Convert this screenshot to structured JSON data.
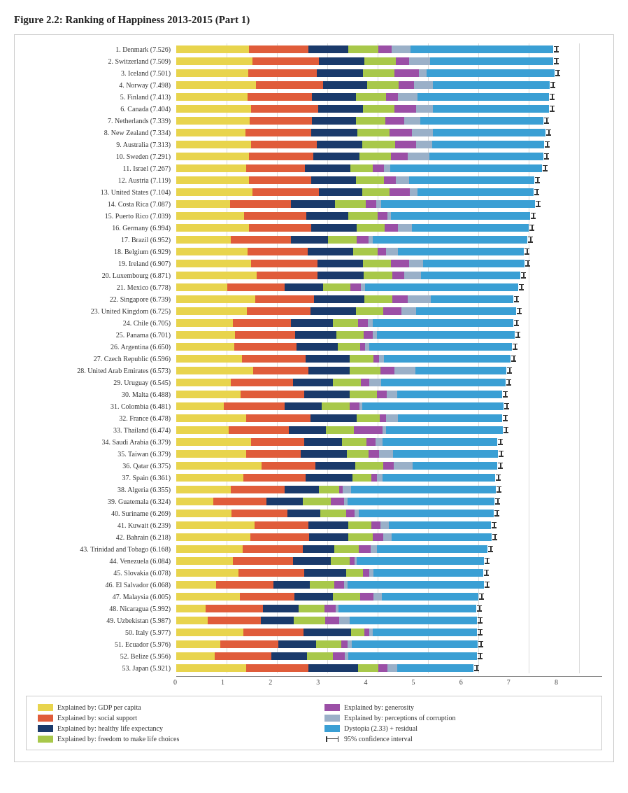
{
  "title": "Figure 2.2: Ranking of Happiness 2013-2015 (Part 1)",
  "colors": {
    "gdp": "#e8d44d",
    "social": "#e05c3a",
    "health": "#1a3a6b",
    "freedom": "#a8c84a",
    "generosity": "#9b4fa6",
    "corruption": "#9ab0c8",
    "dystopia": "#3a9fd4"
  },
  "scale": {
    "min": 0,
    "max": 8,
    "ticks": [
      0,
      1,
      2,
      3,
      4,
      5,
      6,
      7,
      8
    ],
    "pixelsPerUnit": 72
  },
  "countries": [
    {
      "rank": 1,
      "name": "Denmark (7.526)",
      "gdp": 1.44,
      "social": 1.18,
      "health": 0.79,
      "freedom": 0.6,
      "generosity": 0.26,
      "corruption": 0.38,
      "dystopia": 2.84
    },
    {
      "rank": 2,
      "name": "Switzerland (7.509)",
      "gdp": 1.52,
      "social": 1.32,
      "health": 0.9,
      "freedom": 0.62,
      "generosity": 0.26,
      "corruption": 0.41,
      "dystopia": 2.45
    },
    {
      "rank": 3,
      "name": "Iceland (7.501)",
      "gdp": 1.43,
      "social": 1.36,
      "health": 0.91,
      "freedom": 0.63,
      "generosity": 0.48,
      "corruption": 0.15,
      "dystopia": 2.54
    },
    {
      "rank": 4,
      "name": "Norway (7.498)",
      "gdp": 1.58,
      "social": 1.33,
      "health": 0.88,
      "freedom": 0.63,
      "generosity": 0.3,
      "corruption": 0.37,
      "dystopia": 2.32
    },
    {
      "rank": 5,
      "name": "Finland (7.413)",
      "gdp": 1.41,
      "social": 1.28,
      "health": 0.88,
      "freedom": 0.6,
      "generosity": 0.23,
      "corruption": 0.39,
      "dystopia": 2.61
    },
    {
      "rank": 6,
      "name": "Canada (7.404)",
      "gdp": 1.48,
      "social": 1.33,
      "health": 0.89,
      "freedom": 0.63,
      "generosity": 0.43,
      "corruption": 0.33,
      "dystopia": 2.3
    },
    {
      "rank": 7,
      "name": "Netherlands (7.339)",
      "gdp": 1.46,
      "social": 1.23,
      "health": 0.88,
      "freedom": 0.58,
      "generosity": 0.38,
      "corruption": 0.32,
      "dystopia": 2.45
    },
    {
      "rank": 8,
      "name": "New Zealand (7.334)",
      "gdp": 1.37,
      "social": 1.31,
      "health": 0.91,
      "freedom": 0.64,
      "generosity": 0.44,
      "corruption": 0.41,
      "dystopia": 2.24
    },
    {
      "rank": 9,
      "name": "Australia (7.313)",
      "gdp": 1.48,
      "social": 1.31,
      "health": 0.9,
      "freedom": 0.65,
      "generosity": 0.41,
      "corruption": 0.32,
      "dystopia": 2.22
    },
    {
      "rank": 10,
      "name": "Sweden (7.291)",
      "gdp": 1.45,
      "social": 1.28,
      "health": 0.91,
      "freedom": 0.62,
      "generosity": 0.34,
      "corruption": 0.43,
      "dystopia": 2.26
    },
    {
      "rank": 11,
      "name": "Israel (7.267)",
      "gdp": 1.39,
      "social": 1.17,
      "health": 0.9,
      "freedom": 0.45,
      "generosity": 0.22,
      "corruption": 0.12,
      "dystopia": 3.02
    },
    {
      "rank": 12,
      "name": "Austria (7.119)",
      "gdp": 1.45,
      "social": 1.23,
      "health": 0.89,
      "freedom": 0.55,
      "generosity": 0.24,
      "corruption": 0.27,
      "dystopia": 2.49
    },
    {
      "rank": 13,
      "name": "United States (7.104)",
      "gdp": 1.51,
      "social": 1.32,
      "health": 0.86,
      "freedom": 0.54,
      "generosity": 0.4,
      "corruption": 0.15,
      "dystopia": 2.31
    },
    {
      "rank": 14,
      "name": "Costa Rica (7.087)",
      "gdp": 1.07,
      "social": 1.21,
      "health": 0.88,
      "freedom": 0.61,
      "generosity": 0.21,
      "corruption": 0.1,
      "dystopia": 3.05
    },
    {
      "rank": 15,
      "name": "Puerto Rico (7.039)",
      "gdp": 1.35,
      "social": 1.23,
      "health": 0.83,
      "freedom": 0.59,
      "generosity": 0.19,
      "corruption": 0.07,
      "dystopia": 2.76
    },
    {
      "rank": 16,
      "name": "Germany (6.994)",
      "gdp": 1.44,
      "social": 1.24,
      "health": 0.9,
      "freedom": 0.55,
      "generosity": 0.27,
      "corruption": 0.28,
      "dystopia": 2.32
    },
    {
      "rank": 17,
      "name": "Brazil (6.952)",
      "gdp": 1.08,
      "social": 1.19,
      "health": 0.74,
      "freedom": 0.57,
      "generosity": 0.24,
      "corruption": 0.08,
      "dystopia": 3.07
    },
    {
      "rank": 18,
      "name": "Belgium (6.929)",
      "gdp": 1.42,
      "social": 1.2,
      "health": 0.9,
      "freedom": 0.49,
      "generosity": 0.17,
      "corruption": 0.23,
      "dystopia": 2.5
    },
    {
      "rank": 19,
      "name": "Ireland (6.907)",
      "gdp": 1.48,
      "social": 1.32,
      "health": 0.9,
      "freedom": 0.55,
      "generosity": 0.36,
      "corruption": 0.28,
      "dystopia": 2.02
    },
    {
      "rank": 20,
      "name": "Luxembourg (6.871)",
      "gdp": 1.6,
      "social": 1.21,
      "health": 0.91,
      "freedom": 0.57,
      "generosity": 0.23,
      "corruption": 0.34,
      "dystopia": 1.97
    },
    {
      "rank": 21,
      "name": "Mexico (6.778)",
      "gdp": 1.02,
      "social": 1.14,
      "health": 0.76,
      "freedom": 0.54,
      "generosity": 0.21,
      "corruption": 0.08,
      "dystopia": 3.04
    },
    {
      "rank": 22,
      "name": "Singapore (6.739)",
      "gdp": 1.57,
      "social": 1.16,
      "health": 1.0,
      "freedom": 0.56,
      "generosity": 0.31,
      "corruption": 0.46,
      "dystopia": 1.64
    },
    {
      "rank": 23,
      "name": "United Kingdom (6.725)",
      "gdp": 1.4,
      "social": 1.26,
      "health": 0.9,
      "freedom": 0.54,
      "generosity": 0.36,
      "corruption": 0.29,
      "dystopia": 1.98
    },
    {
      "rank": 24,
      "name": "Chile (6.705)",
      "gdp": 1.13,
      "social": 1.15,
      "health": 0.84,
      "freedom": 0.5,
      "generosity": 0.19,
      "corruption": 0.1,
      "dystopia": 2.79
    },
    {
      "rank": 25,
      "name": "Panama (6.701)",
      "gdp": 1.17,
      "social": 1.2,
      "health": 0.82,
      "freedom": 0.54,
      "generosity": 0.18,
      "corruption": 0.09,
      "dystopia": 2.73
    },
    {
      "rank": 26,
      "name": "Argentina (6.650)",
      "gdp": 1.15,
      "social": 1.23,
      "health": 0.82,
      "freedom": 0.44,
      "generosity": 0.1,
      "corruption": 0.08,
      "dystopia": 2.83
    },
    {
      "rank": 27,
      "name": "Czech Republic (6.596)",
      "gdp": 1.3,
      "social": 1.27,
      "health": 0.87,
      "freedom": 0.47,
      "generosity": 0.11,
      "corruption": 0.1,
      "dystopia": 2.51
    },
    {
      "rank": 28,
      "name": "United Arab Emirates (6.573)",
      "gdp": 1.53,
      "social": 1.1,
      "health": 0.82,
      "freedom": 0.61,
      "generosity": 0.28,
      "corruption": 0.41,
      "dystopia": 1.81
    },
    {
      "rank": 29,
      "name": "Uruguay (6.545)",
      "gdp": 1.09,
      "social": 1.23,
      "health": 0.79,
      "freedom": 0.56,
      "generosity": 0.16,
      "corruption": 0.24,
      "dystopia": 2.47
    },
    {
      "rank": 30,
      "name": "Malta (6.488)",
      "gdp": 1.28,
      "social": 1.27,
      "health": 0.9,
      "freedom": 0.54,
      "generosity": 0.19,
      "corruption": 0.21,
      "dystopia": 2.09
    },
    {
      "rank": 31,
      "name": "Colombia (6.481)",
      "gdp": 0.94,
      "social": 1.21,
      "health": 0.74,
      "freedom": 0.55,
      "generosity": 0.19,
      "corruption": 0.05,
      "dystopia": 2.81
    },
    {
      "rank": 32,
      "name": "France (6.478)",
      "gdp": 1.39,
      "social": 1.28,
      "health": 0.92,
      "freedom": 0.46,
      "generosity": 0.12,
      "corruption": 0.23,
      "dystopia": 2.07
    },
    {
      "rank": 33,
      "name": "Thailand (6.474)",
      "gdp": 1.04,
      "social": 1.2,
      "health": 0.73,
      "freedom": 0.55,
      "generosity": 0.57,
      "corruption": 0.07,
      "dystopia": 2.32
    },
    {
      "rank": 34,
      "name": "Saudi Arabia (6.379)",
      "gdp": 1.48,
      "social": 1.05,
      "health": 0.75,
      "freedom": 0.49,
      "generosity": 0.18,
      "corruption": 0.14,
      "dystopia": 2.28
    },
    {
      "rank": 35,
      "name": "Taiwan (6.379)",
      "gdp": 1.39,
      "social": 1.09,
      "health": 0.91,
      "freedom": 0.43,
      "generosity": 0.21,
      "corruption": 0.28,
      "dystopia": 2.09
    },
    {
      "rank": 36,
      "name": "Qatar (6.375)",
      "gdp": 1.69,
      "social": 1.07,
      "health": 0.79,
      "freedom": 0.56,
      "generosity": 0.21,
      "corruption": 0.38,
      "dystopia": 1.68
    },
    {
      "rank": 37,
      "name": "Spain (6.361)",
      "gdp": 1.34,
      "social": 1.24,
      "health": 0.93,
      "freedom": 0.38,
      "generosity": 0.11,
      "corruption": 0.11,
      "dystopia": 2.24
    },
    {
      "rank": 38,
      "name": "Algeria (6.355)",
      "gdp": 1.09,
      "social": 1.07,
      "health": 0.68,
      "freedom": 0.4,
      "generosity": 0.07,
      "corruption": 0.17,
      "dystopia": 2.88
    },
    {
      "rank": 39,
      "name": "Guatemala (6.324)",
      "gdp": 0.74,
      "social": 1.05,
      "health": 0.72,
      "freedom": 0.56,
      "generosity": 0.27,
      "corruption": 0.07,
      "dystopia": 2.92
    },
    {
      "rank": 40,
      "name": "Suriname (6.269)",
      "gdp": 1.1,
      "social": 1.11,
      "health": 0.65,
      "freedom": 0.51,
      "generosity": 0.16,
      "corruption": 0.09,
      "dystopia": 2.68
    },
    {
      "rank": 41,
      "name": "Kuwait (6.239)",
      "gdp": 1.55,
      "social": 1.07,
      "health": 0.79,
      "freedom": 0.46,
      "generosity": 0.18,
      "corruption": 0.17,
      "dystopia": 2.03
    },
    {
      "rank": 42,
      "name": "Bahrain (6.218)",
      "gdp": 1.47,
      "social": 1.16,
      "health": 0.78,
      "freedom": 0.48,
      "generosity": 0.21,
      "corruption": 0.16,
      "dystopia": 1.98
    },
    {
      "rank": 43,
      "name": "Trinidad and Tobago (6.168)",
      "gdp": 1.32,
      "social": 1.19,
      "health": 0.62,
      "freedom": 0.49,
      "generosity": 0.24,
      "corruption": 0.12,
      "dystopia": 2.2
    },
    {
      "rank": 44,
      "name": "Venezuela (6.084)",
      "gdp": 1.13,
      "social": 1.2,
      "health": 0.75,
      "freedom": 0.37,
      "generosity": 0.1,
      "corruption": 0.04,
      "dystopia": 2.53
    },
    {
      "rank": 45,
      "name": "Slovakia (6.078)",
      "gdp": 1.24,
      "social": 1.3,
      "health": 0.84,
      "freedom": 0.33,
      "generosity": 0.12,
      "corruption": 0.08,
      "dystopia": 2.18
    },
    {
      "rank": 46,
      "name": "El Salvador (6.068)",
      "gdp": 0.79,
      "social": 1.14,
      "health": 0.72,
      "freedom": 0.48,
      "generosity": 0.2,
      "corruption": 0.07,
      "dystopia": 2.71
    },
    {
      "rank": 47,
      "name": "Malaysia (6.005)",
      "gdp": 1.27,
      "social": 1.09,
      "health": 0.77,
      "freedom": 0.54,
      "generosity": 0.26,
      "corruption": 0.16,
      "dystopia": 1.92
    },
    {
      "rank": 48,
      "name": "Nicaragua (5.992)",
      "gdp": 0.59,
      "social": 1.14,
      "health": 0.71,
      "freedom": 0.52,
      "generosity": 0.22,
      "corruption": 0.06,
      "dystopia": 2.74
    },
    {
      "rank": 49,
      "name": "Uzbekistan (5.987)",
      "gdp": 0.63,
      "social": 1.06,
      "health": 0.65,
      "freedom": 0.63,
      "generosity": 0.28,
      "corruption": 0.21,
      "dystopia": 2.53
    },
    {
      "rank": 50,
      "name": "Italy (5.977)",
      "gdp": 1.34,
      "social": 1.19,
      "health": 0.95,
      "freedom": 0.26,
      "generosity": 0.1,
      "corruption": 0.07,
      "dystopia": 2.07
    },
    {
      "rank": 51,
      "name": "Ecuador (5.976)",
      "gdp": 0.87,
      "social": 1.15,
      "health": 0.75,
      "freedom": 0.5,
      "generosity": 0.13,
      "corruption": 0.08,
      "dystopia": 2.5
    },
    {
      "rank": 52,
      "name": "Belize (5.956)",
      "gdp": 0.76,
      "social": 1.12,
      "health": 0.71,
      "freedom": 0.52,
      "generosity": 0.24,
      "corruption": 0.07,
      "dystopia": 2.55
    },
    {
      "rank": 53,
      "name": "Japan (5.921)",
      "gdp": 1.39,
      "social": 1.24,
      "health": 0.98,
      "freedom": 0.4,
      "generosity": 0.18,
      "corruption": 0.2,
      "dystopia": 1.51
    }
  ],
  "legend": {
    "items": [
      {
        "label": "Explained by: GDP per capita",
        "color": "#e8d44d",
        "type": "box"
      },
      {
        "label": "Explained by: generosity",
        "color": "#9b4fa6",
        "type": "box"
      },
      {
        "label": "Explained by: social support",
        "color": "#e05c3a",
        "type": "box"
      },
      {
        "label": "Explained by: perceptions of corruption",
        "color": "#9ab0c8",
        "type": "box"
      },
      {
        "label": "Explained by: healthy life expectancy",
        "color": "#1a3a6b",
        "type": "box"
      },
      {
        "label": "Dystopia (2.33) + residual",
        "color": "#3a9fd4",
        "type": "box"
      },
      {
        "label": "Explained by: freedom to make life choices",
        "color": "#a8c84a",
        "type": "box"
      },
      {
        "label": "95% confidence interval",
        "color": "#333",
        "type": "error"
      }
    ]
  }
}
